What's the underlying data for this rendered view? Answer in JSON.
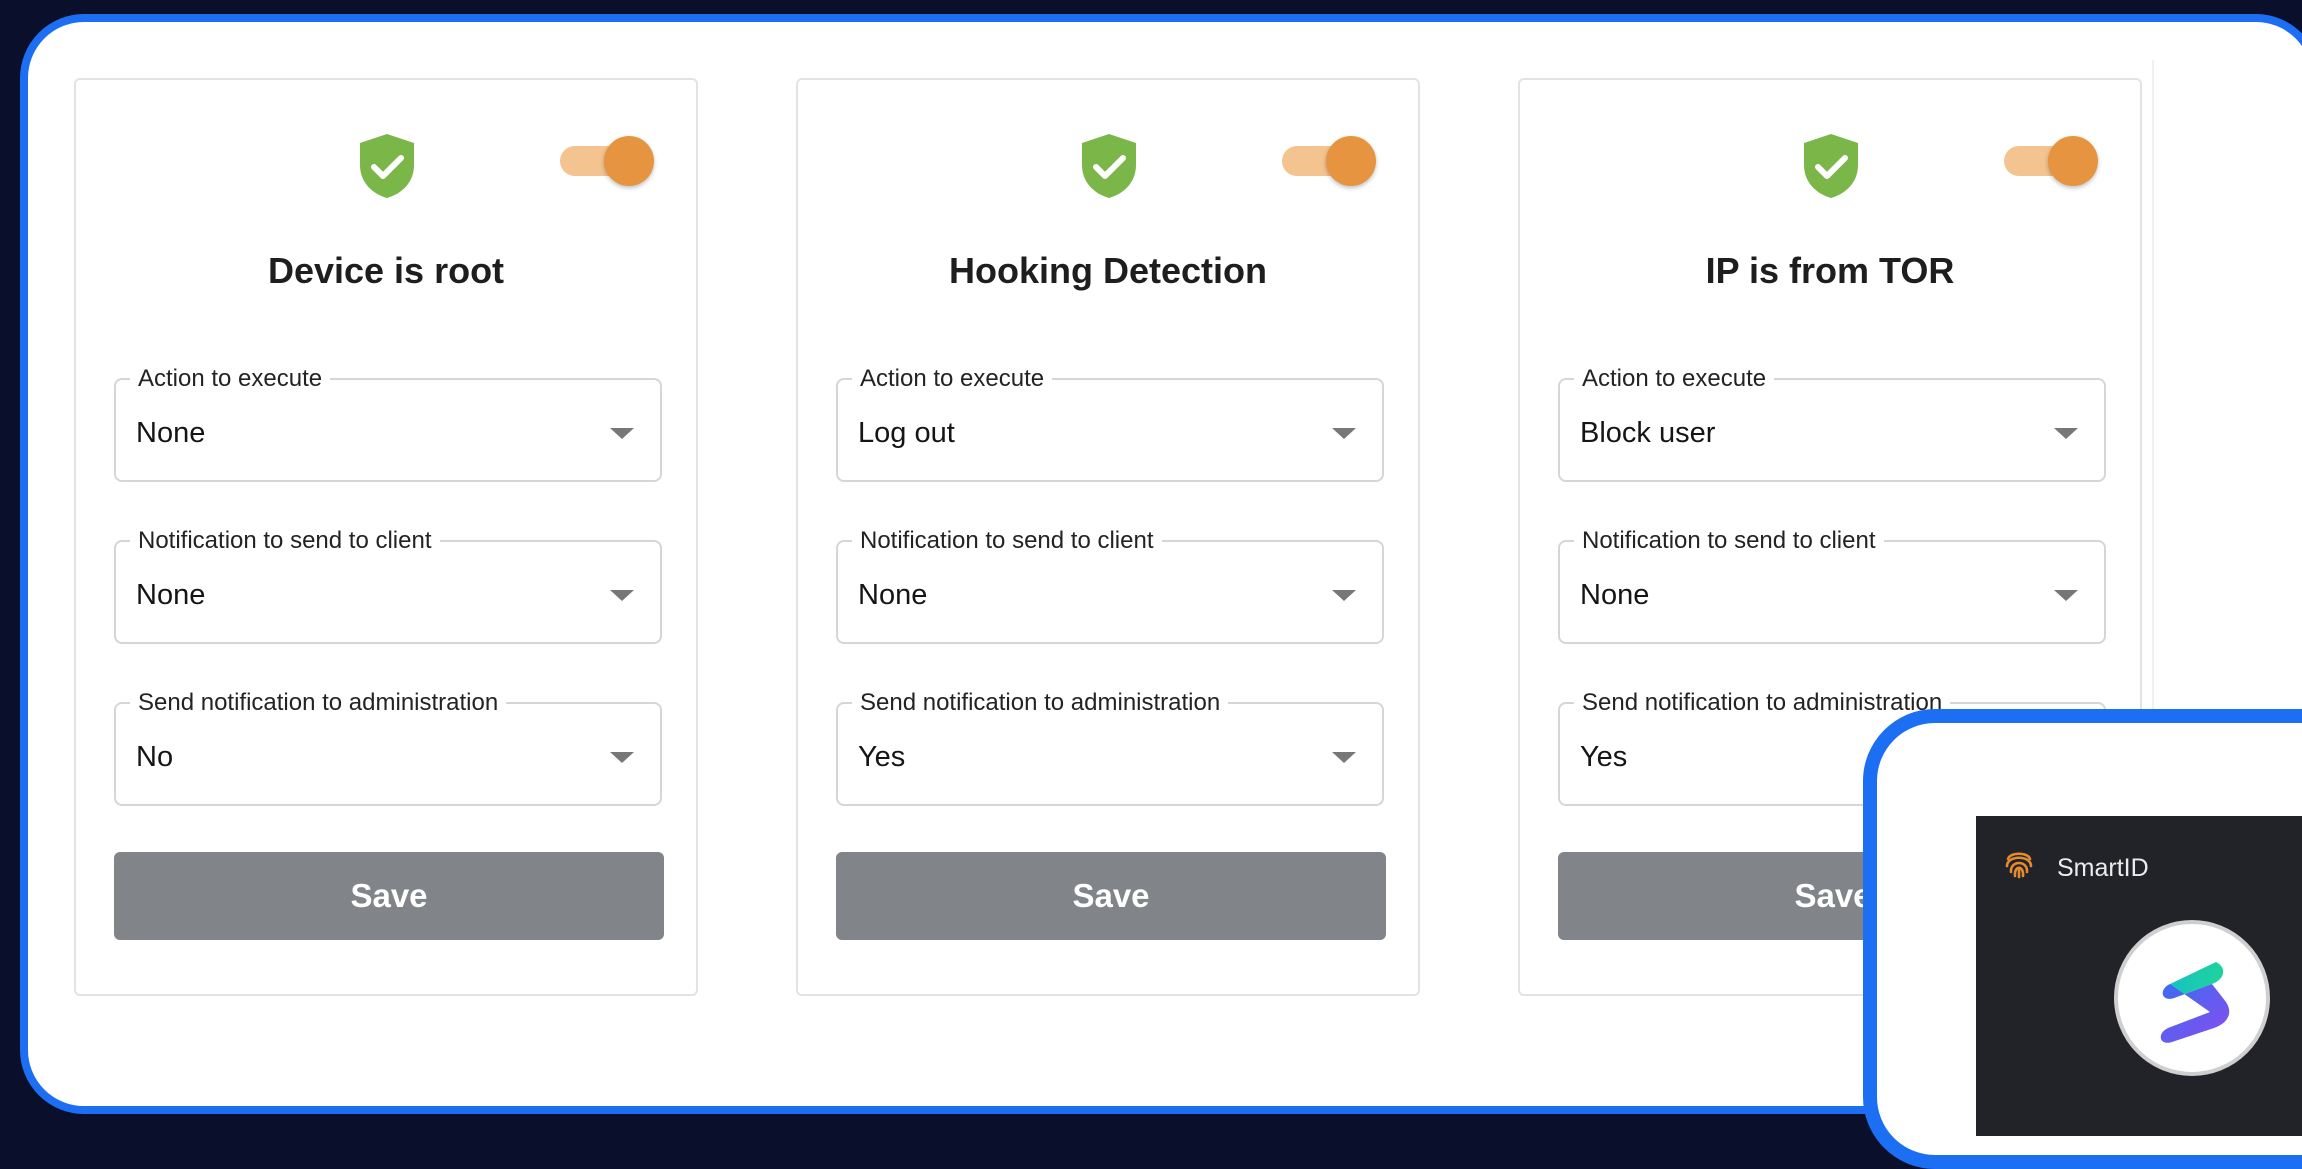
{
  "colors": {
    "accent": "#1c6ef2",
    "shield_green": "#7ab648",
    "toggle_on": "#e6943f",
    "save_button": "#818489"
  },
  "cards": [
    {
      "title": "Device is root",
      "enabled": true,
      "icon": "shield-check-icon",
      "fields": [
        {
          "label": "Action to execute",
          "value": "None"
        },
        {
          "label": "Notification to send to client",
          "value": "None"
        },
        {
          "label": "Send notification to administration",
          "value": "No"
        }
      ],
      "save_label": "Save"
    },
    {
      "title": "Hooking Detection",
      "enabled": true,
      "icon": "shield-check-icon",
      "fields": [
        {
          "label": "Action to execute",
          "value": "Log out"
        },
        {
          "label": "Notification to send to client",
          "value": "None"
        },
        {
          "label": "Send notification to administration",
          "value": "Yes"
        }
      ],
      "save_label": "Save"
    },
    {
      "title": "IP is from TOR",
      "enabled": true,
      "icon": "shield-check-icon",
      "fields": [
        {
          "label": "Action to execute",
          "value": "Block user"
        },
        {
          "label": "Notification to send to client",
          "value": "None"
        },
        {
          "label": "Send notification to administration",
          "value": "Yes"
        }
      ],
      "save_label": "Save"
    }
  ],
  "phone": {
    "app_name": "SmartID",
    "app_icon": "fingerprint-icon",
    "avatar_icon": "s-logo-icon"
  }
}
